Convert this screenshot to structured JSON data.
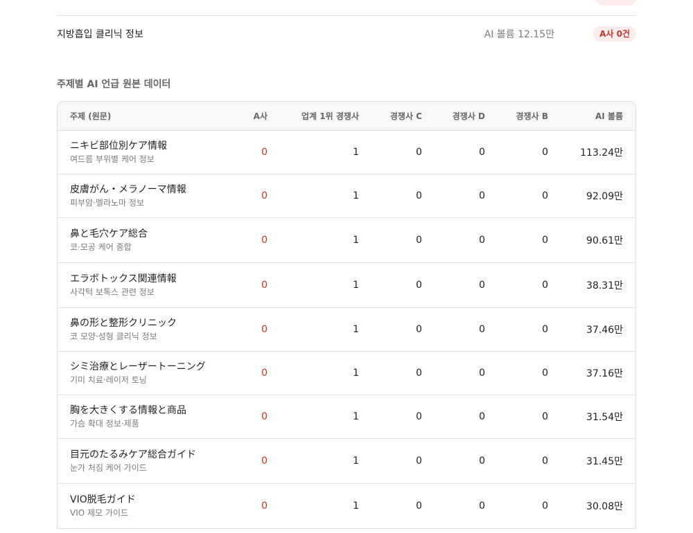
{
  "summary": {
    "topic": "지방흡입 클리닉 정보",
    "volume": "AI 볼륨 12.15만",
    "badge": "A사 0건"
  },
  "section_title": "주제별 AI 언급 원본 데이터",
  "table": {
    "headers": {
      "topic": "주제 (원문)",
      "a": "A사",
      "leader": "업계 1위 경쟁사",
      "c": "경쟁사 C",
      "d": "경쟁사 D",
      "b": "경쟁사 B",
      "volume": "AI 볼륨"
    },
    "rows": [
      {
        "title": "ニキビ部位別ケア情報",
        "subtitle": "여드름 부위별 케어 정보",
        "a": "0",
        "leader": "1",
        "c": "0",
        "d": "0",
        "b": "0",
        "volume": "113.24만"
      },
      {
        "title": "皮膚がん・メラノーマ情報",
        "subtitle": "피부암·멜라노마 정보",
        "a": "0",
        "leader": "1",
        "c": "0",
        "d": "0",
        "b": "0",
        "volume": "92.09만"
      },
      {
        "title": "鼻と毛穴ケア総合",
        "subtitle": "코·모공 케어 종합",
        "a": "0",
        "leader": "1",
        "c": "0",
        "d": "0",
        "b": "0",
        "volume": "90.61만"
      },
      {
        "title": "エラボトックス関連情報",
        "subtitle": "사각턱 보톡스 관련 정보",
        "a": "0",
        "leader": "1",
        "c": "0",
        "d": "0",
        "b": "0",
        "volume": "38.31만"
      },
      {
        "title": "鼻の形と整形クリニック",
        "subtitle": "코 모양·성형 클리닉 정보",
        "a": "0",
        "leader": "1",
        "c": "0",
        "d": "0",
        "b": "0",
        "volume": "37.46만"
      },
      {
        "title": "シミ治療とレーザートーニング",
        "subtitle": "기미 치료·레이저 토닝",
        "a": "0",
        "leader": "1",
        "c": "0",
        "d": "0",
        "b": "0",
        "volume": "37.16만"
      },
      {
        "title": "胸を大きくする情報と商品",
        "subtitle": "가슴 확대 정보·제품",
        "a": "0",
        "leader": "1",
        "c": "0",
        "d": "0",
        "b": "0",
        "volume": "31.54만"
      },
      {
        "title": "目元のたるみケア総合ガイド",
        "subtitle": "눈가 처짐 케어 가이드",
        "a": "0",
        "leader": "1",
        "c": "0",
        "d": "0",
        "b": "0",
        "volume": "31.45만"
      },
      {
        "title": "VIO脱毛ガイド",
        "subtitle": "VIO 제모 가이드",
        "a": "0",
        "leader": "1",
        "c": "0",
        "d": "0",
        "b": "0",
        "volume": "30.08만"
      }
    ]
  },
  "colors": {
    "accent_red": "#c0392b",
    "badge_bg": "#fdecec",
    "muted_text": "#7a7a7a",
    "border": "#dddddd"
  }
}
